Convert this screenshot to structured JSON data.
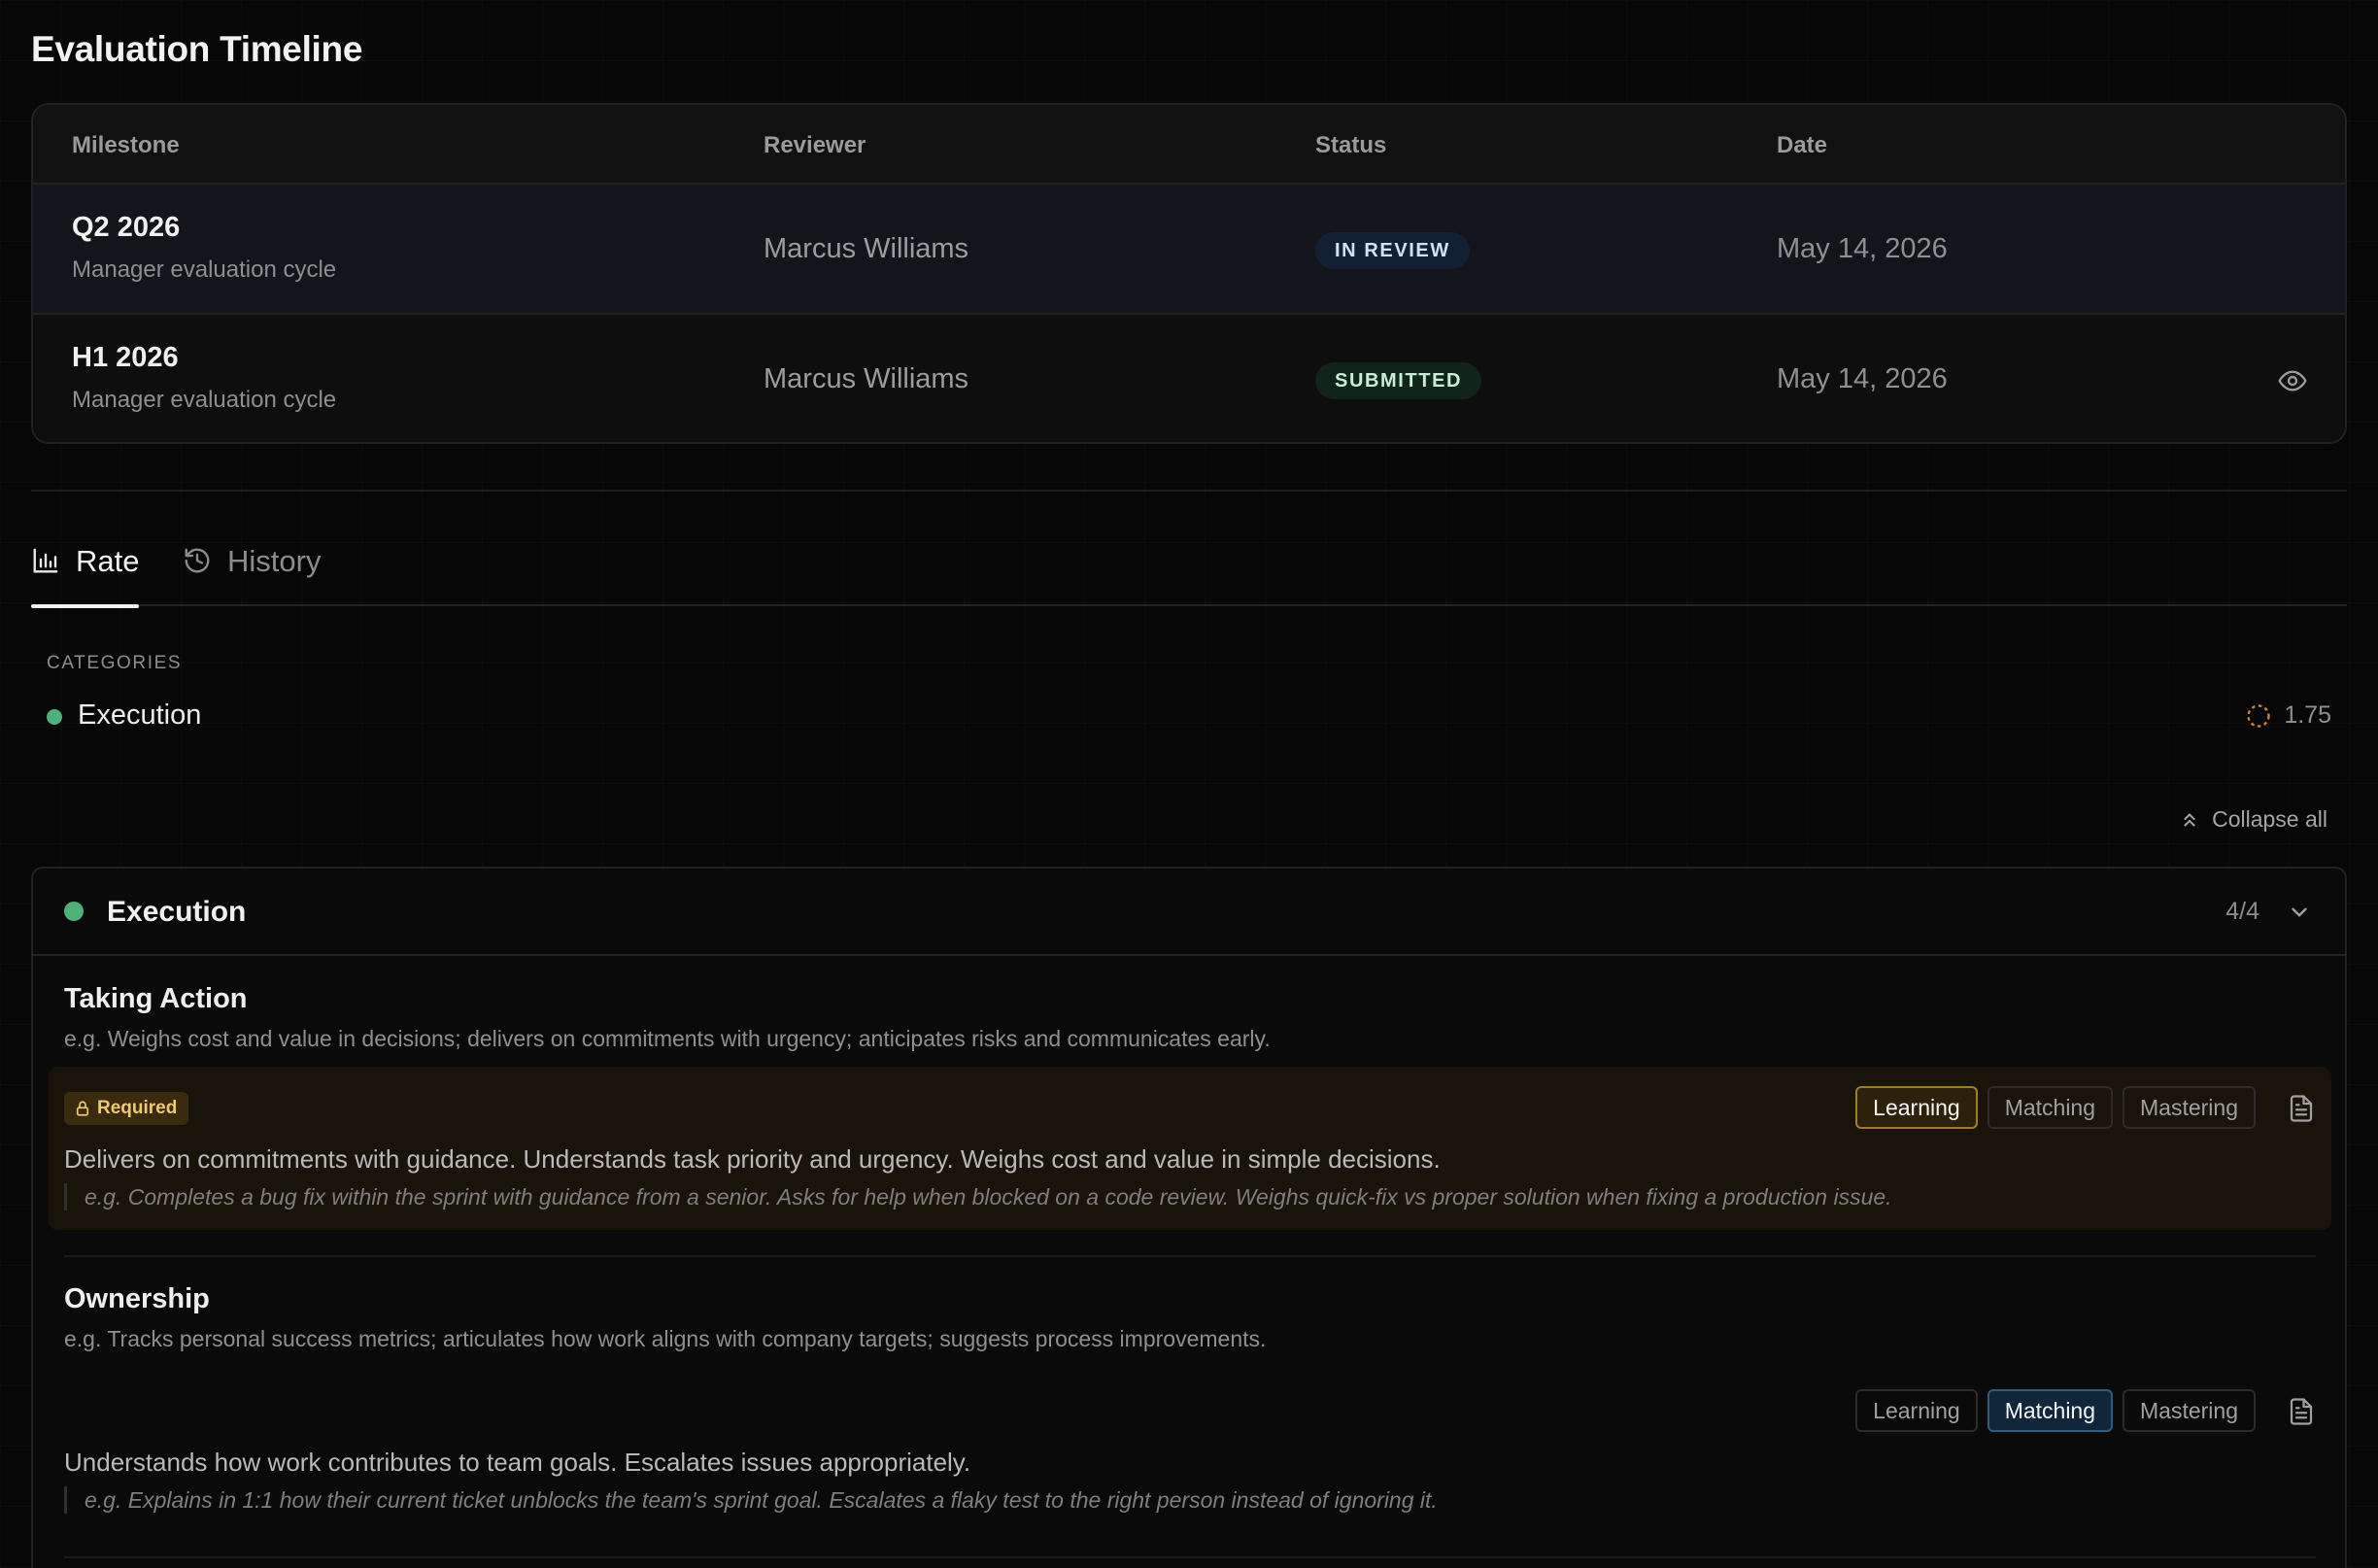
{
  "page": {
    "title": "Evaluation Timeline"
  },
  "timeline": {
    "columns": [
      "Milestone",
      "Reviewer",
      "Status",
      "Date"
    ],
    "rows": [
      {
        "milestone": "Q2 2026",
        "subtitle": "Manager evaluation cycle",
        "reviewer": "Marcus Williams",
        "status": "IN REVIEW",
        "date": "May 14, 2026",
        "action_icon": ""
      },
      {
        "milestone": "H1 2026",
        "subtitle": "Manager evaluation cycle",
        "reviewer": "Marcus Williams",
        "status": "SUBMITTED",
        "date": "May 14, 2026",
        "action_icon": "eye-icon"
      }
    ]
  },
  "tabs": [
    {
      "label": "Rate",
      "icon": "bar-chart-icon",
      "active": true
    },
    {
      "label": "History",
      "icon": "history-icon",
      "active": false
    }
  ],
  "categories": {
    "heading": "CATEGORIES",
    "items": [
      {
        "name": "Execution",
        "score": "1.75",
        "color": "#4fb07a"
      }
    ]
  },
  "collapse_all_label": "Collapse all",
  "section": {
    "title": "Execution",
    "count": "4/4",
    "items": [
      {
        "title": "Taking Action",
        "eg": "e.g. Weighs cost and value in decisions; delivers on commitments with urgency; anticipates risks and communicates early.",
        "required_label": "Required",
        "levels": [
          "Learning",
          "Matching",
          "Mastering"
        ],
        "selected": "Learning",
        "description": "Delivers on commitments with guidance. Understands task priority and urgency. Weighs cost and value in simple decisions.",
        "example": "e.g. Completes a bug fix within the sprint with guidance from a senior. Asks for help when blocked on a code review. Weighs quick-fix vs proper solution when fixing a production issue."
      },
      {
        "title": "Ownership",
        "eg": "e.g. Tracks personal success metrics; articulates how work aligns with company targets; suggests process improvements.",
        "levels": [
          "Learning",
          "Matching",
          "Mastering"
        ],
        "selected": "Matching",
        "description": "Understands how work contributes to team goals. Escalates issues appropriately.",
        "example": "e.g. Explains in 1:1 how their current ticket unblocks the team's sprint goal. Escalates a flaky test to the right person instead of ignoring it."
      }
    ]
  },
  "colors": {
    "accent_green": "#4fb07a",
    "required_amber": "#f0c871",
    "score_ring": "#d9822b"
  }
}
